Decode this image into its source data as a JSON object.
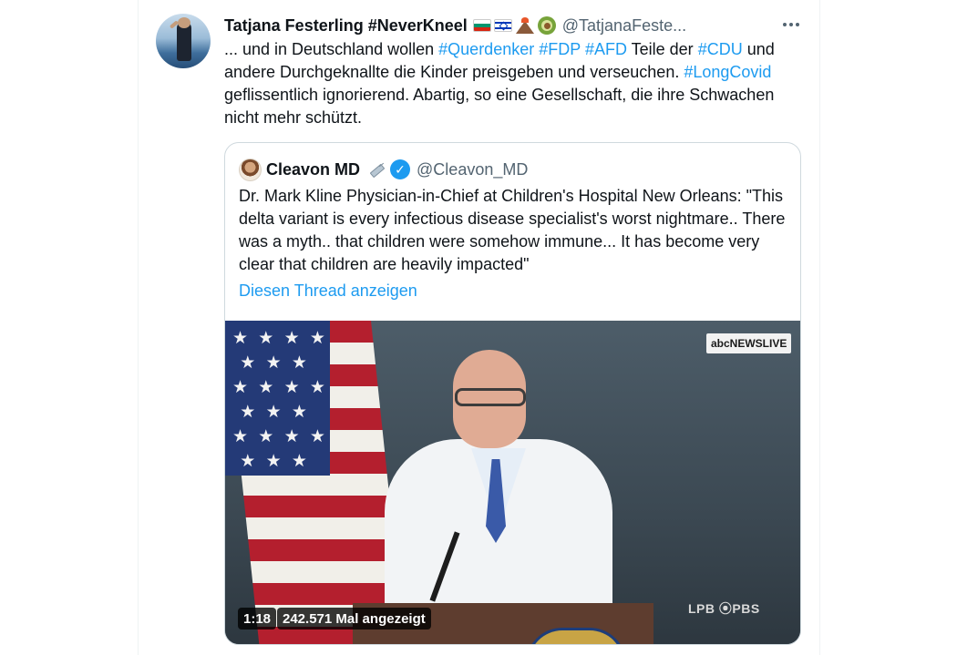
{
  "tweet": {
    "display_name": "Tatjana Festerling #NeverKneel",
    "emoji_icons": [
      "flag-bulgaria-icon",
      "flag-israel-icon",
      "volcano-icon",
      "avocado-icon"
    ],
    "handle": "@TatjanaFeste...",
    "text_parts": [
      {
        "text": "... und in Deutschland wollen ",
        "tag": false
      },
      {
        "text": "#Querdenker",
        "tag": true
      },
      {
        "text": " ",
        "tag": false
      },
      {
        "text": "#FDP",
        "tag": true
      },
      {
        "text": " ",
        "tag": false
      },
      {
        "text": "#AFD",
        "tag": true
      },
      {
        "text": " Teile der ",
        "tag": false
      },
      {
        "text": "#CDU",
        "tag": true
      },
      {
        "text": " und andere Durchgeknallte die Kinder preisgeben und verseuchen. ",
        "tag": false
      },
      {
        "text": "#LongCovid",
        "tag": true
      },
      {
        "text": " geflissentlich ignorierend. Abartig, so eine Gesellschaft, die ihre Schwachen nicht mehr schützt.",
        "tag": false
      }
    ]
  },
  "quote": {
    "display_name": "Cleavon MD",
    "handle": "@Cleavon_MD",
    "verified_mark": "✓",
    "text": "Dr. Mark Kline Physician-in-Chief at Children's Hospital New Orleans: \"This delta variant is every infectious disease specialist's worst nightmare.. There was a myth.. that children were somehow immune... It has become very clear that children are heavily impacted\"",
    "thread_link": "Diesen Thread anzeigen"
  },
  "video": {
    "duration": "1:18",
    "views": "242.571 Mal angezeigt",
    "news_logo": "abcNEWSLIVE",
    "pbs_logo": "LPB ⦿PBS"
  },
  "colors": {
    "link": "#1d9bf0",
    "text": "#0f1419",
    "secondary": "#536471",
    "border": "#cfd9de"
  }
}
